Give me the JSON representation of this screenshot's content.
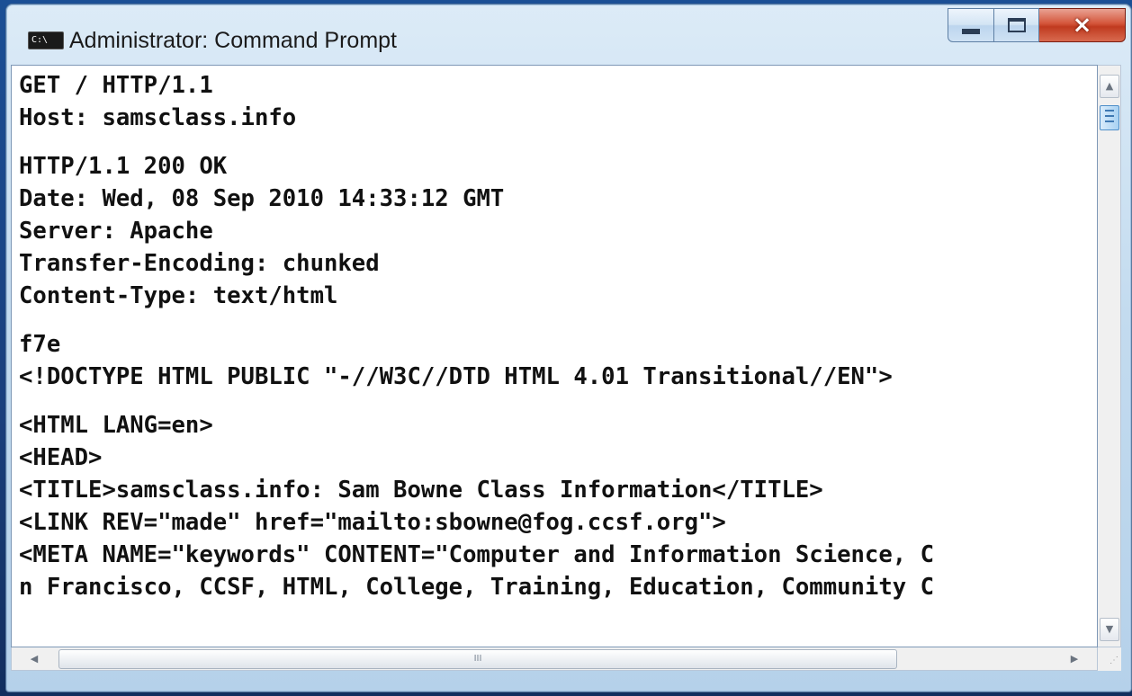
{
  "window": {
    "title": "Administrator: Command Prompt",
    "icon_text": "C:\\",
    "controls": {
      "minimize": "minimize-icon",
      "maximize": "maximize-icon",
      "close": "×"
    }
  },
  "console": {
    "lines": [
      "GET / HTTP/1.1",
      "Host: samsclass.info",
      "",
      "HTTP/1.1 200 OK",
      "Date: Wed, 08 Sep 2010 14:33:12 GMT",
      "Server: Apache",
      "Transfer-Encoding: chunked",
      "Content-Type: text/html",
      "",
      "f7e",
      "<!DOCTYPE HTML PUBLIC \"-//W3C//DTD HTML 4.01 Transitional//EN\">",
      "",
      "<HTML LANG=en>",
      "<HEAD>",
      "<TITLE>samsclass.info: Sam Bowne Class Information</TITLE>",
      "<LINK REV=\"made\" href=\"mailto:sbowne@fog.ccsf.org\">",
      "<META NAME=\"keywords\" CONTENT=\"Computer and Information Science, C",
      "n Francisco, CCSF, HTML, College, Training, Education, Community C"
    ]
  },
  "scrollbars": {
    "vertical": {
      "up": "▲",
      "down": "▼"
    },
    "horizontal": {
      "left": "◀",
      "right": "▶",
      "thumb_grip": "III"
    }
  },
  "colors": {
    "console_bg": "#ffffff",
    "console_text": "#111111",
    "close_button": "#c8432a"
  }
}
